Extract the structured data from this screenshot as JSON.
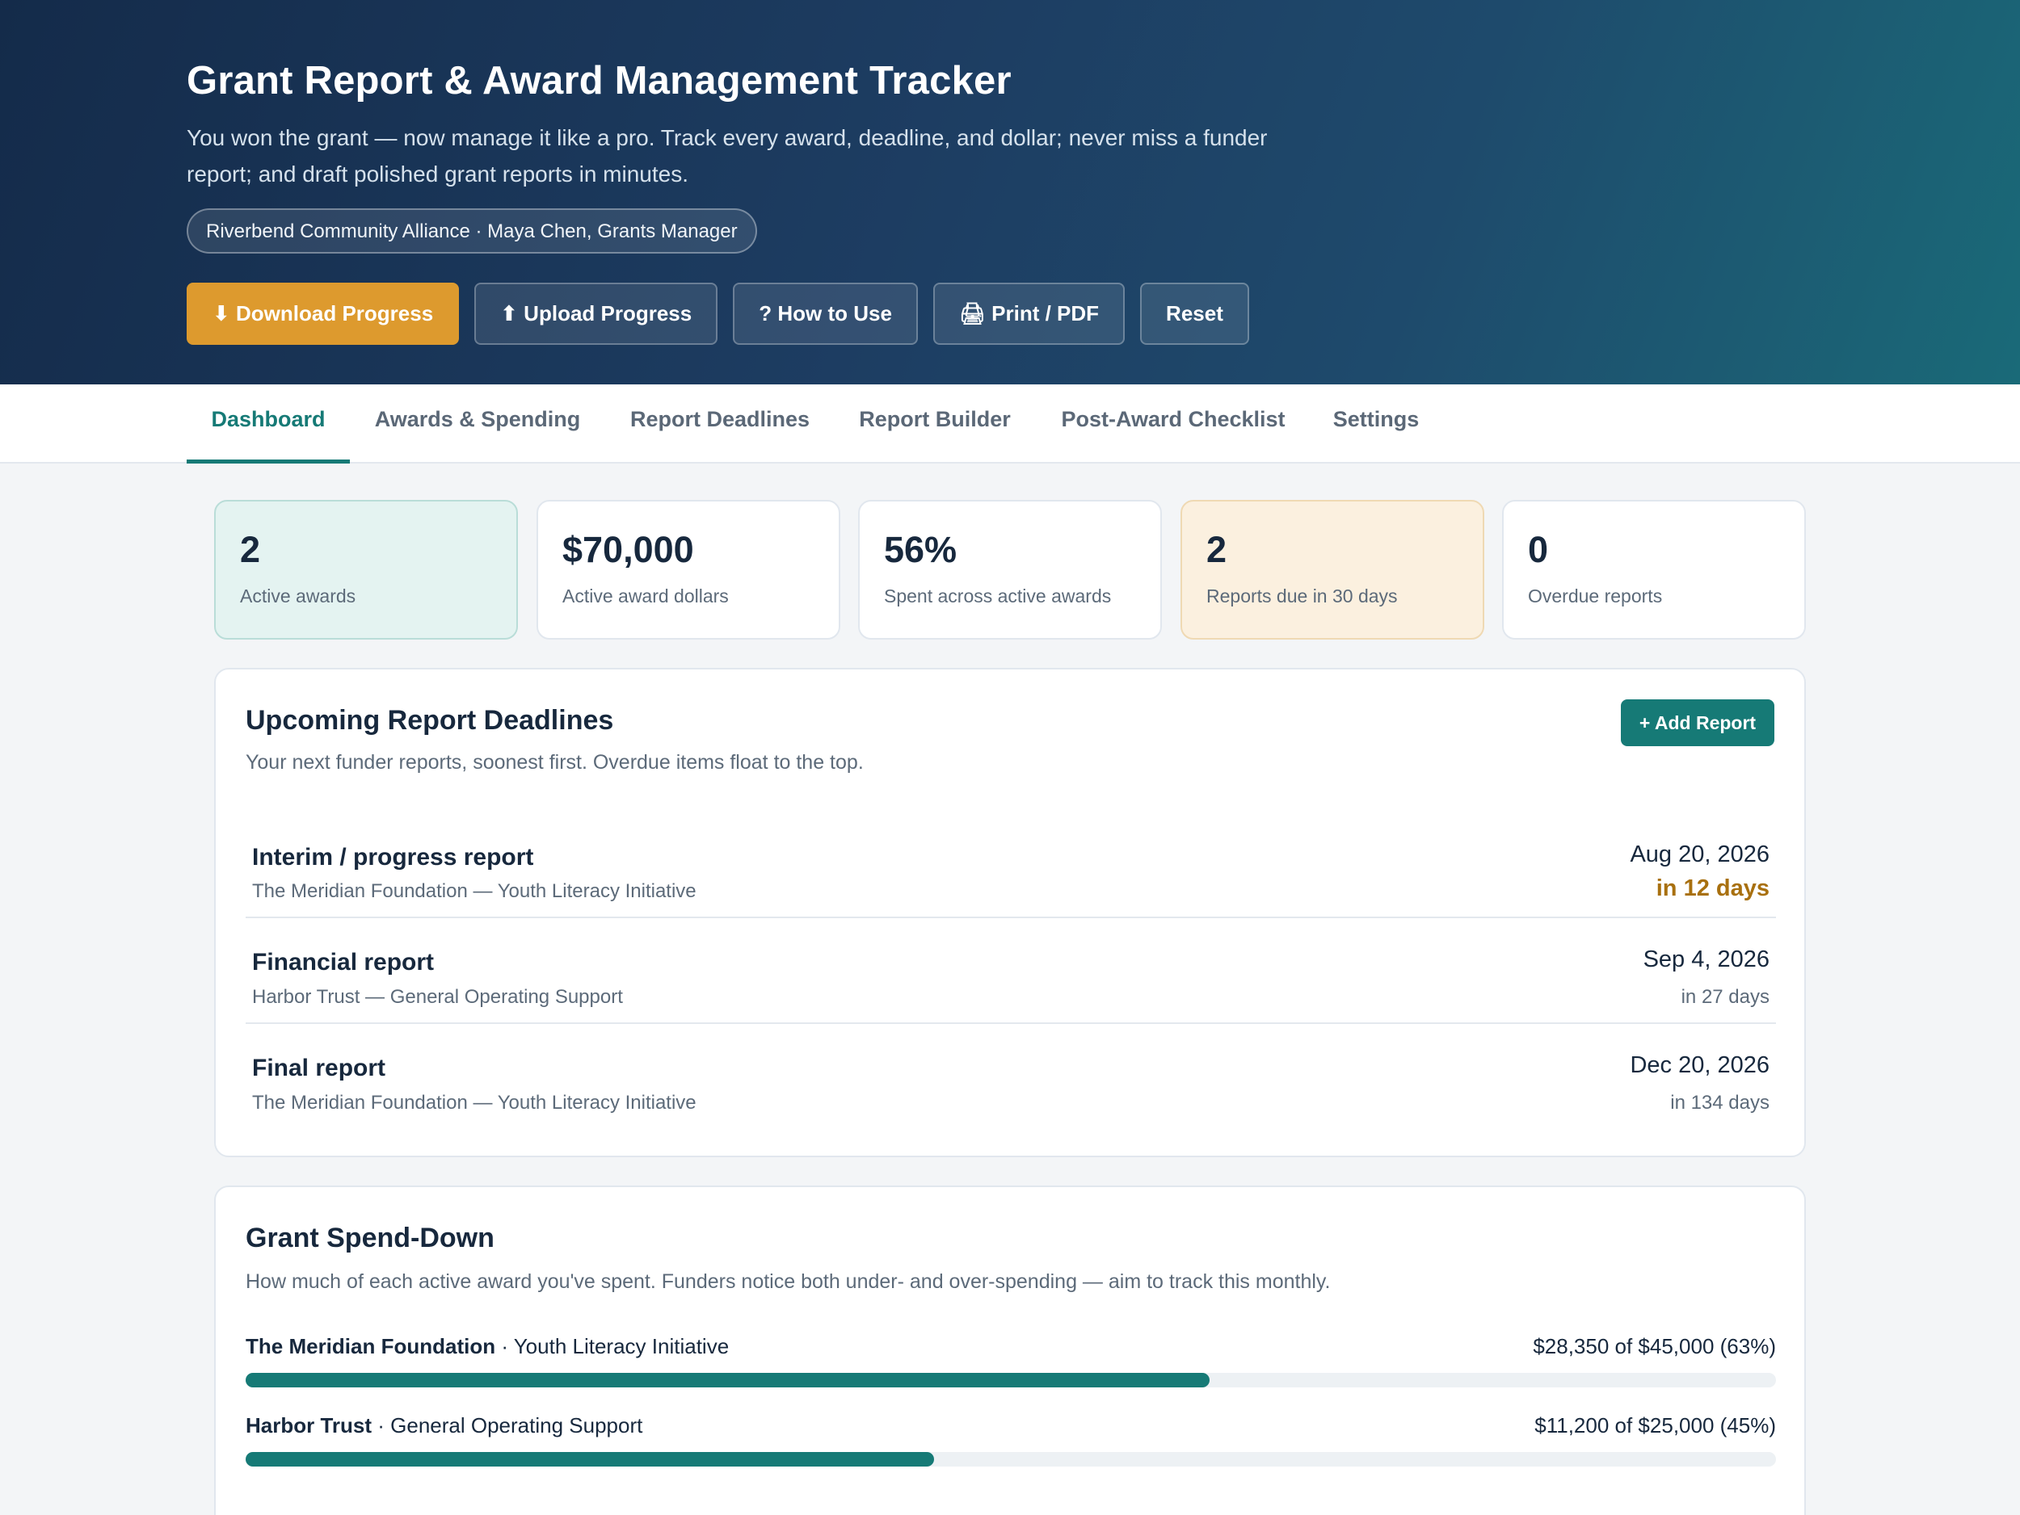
{
  "header": {
    "title": "Grant Report & Award Management Tracker",
    "subtitle": "You won the grant — now manage it like a pro. Track every award, deadline, and dollar; never miss a funder report; and draft polished grant reports in minutes.",
    "org_pill": "Riverbend Community Alliance · Maya Chen, Grants Manager",
    "buttons": {
      "download": "⬇ Download Progress",
      "upload": "⬆ Upload Progress",
      "how_to": "? How to Use",
      "print": "🖨 Print / PDF",
      "reset": "Reset"
    }
  },
  "tabs": [
    {
      "label": "Dashboard",
      "active": true
    },
    {
      "label": "Awards & Spending"
    },
    {
      "label": "Report Deadlines"
    },
    {
      "label": "Report Builder"
    },
    {
      "label": "Post-Award Checklist"
    },
    {
      "label": "Settings"
    }
  ],
  "stats": [
    {
      "value": "2",
      "label": "Active awards"
    },
    {
      "value": "$70,000",
      "label": "Active award dollars"
    },
    {
      "value": "56%",
      "label": "Spent across active awards"
    },
    {
      "value": "2",
      "label": "Reports due in 30 days"
    },
    {
      "value": "0",
      "label": "Overdue reports"
    }
  ],
  "deadlines_card": {
    "title": "Upcoming Report Deadlines",
    "desc": "Your next funder reports, soonest first. Overdue items float to the top.",
    "add_button": "+ Add Report",
    "items": [
      {
        "name": "Interim / progress report",
        "funder": "The Meridian Foundation — Youth Literacy Initiative",
        "date": "Aug 20, 2026",
        "relative": "in 12 days"
      },
      {
        "name": "Financial report",
        "funder": "Harbor Trust — General Operating Support",
        "date": "Sep 4, 2026",
        "relative": "in 27 days"
      },
      {
        "name": "Final report",
        "funder": "The Meridian Foundation — Youth Literacy Initiative",
        "date": "Dec 20, 2026",
        "relative": "in 134 days"
      }
    ]
  },
  "spend_card": {
    "title": "Grant Spend-Down",
    "desc": "How much of each active award you've spent. Funders notice both under- and over-spending — aim to track this monthly.",
    "items": [
      {
        "funder": "The Meridian Foundation",
        "program": " · Youth Literacy Initiative",
        "amount": "$28,350 of $45,000 (63%)",
        "fraction": 0.63
      },
      {
        "funder": "Harbor Trust",
        "program": " · General Operating Support",
        "amount": "$11,200 of $25,000 (45%)",
        "fraction": 0.45
      }
    ]
  },
  "colors": {
    "accent": "#167a76",
    "primary_button": "#dd9a2e",
    "soon": "#a8700f"
  }
}
